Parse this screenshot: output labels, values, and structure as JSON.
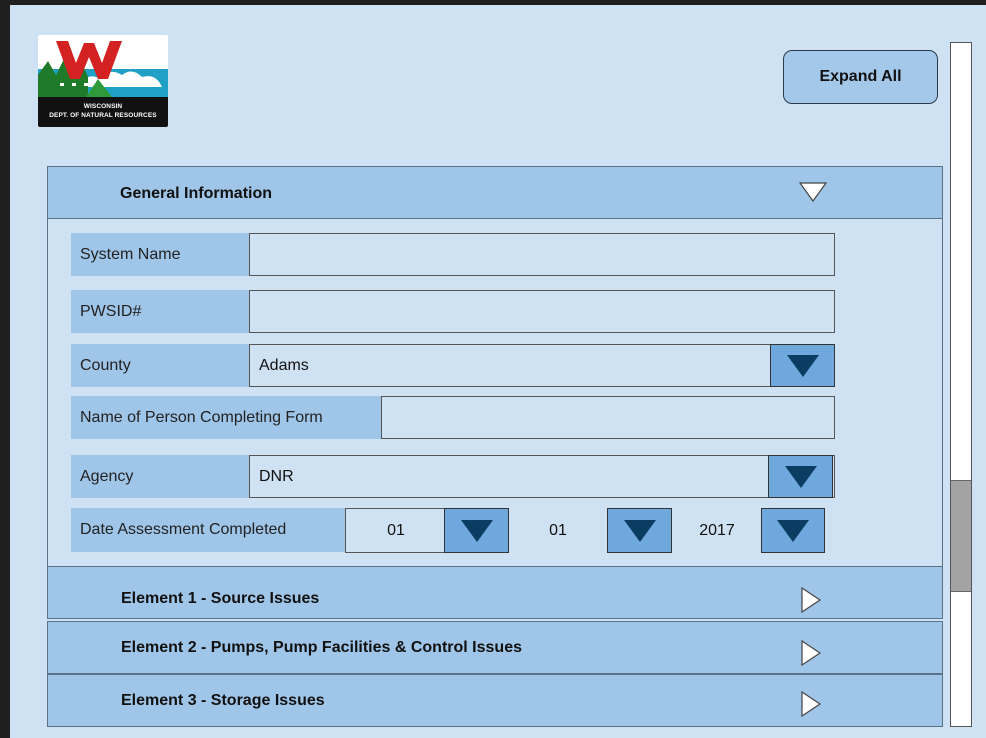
{
  "logo": {
    "line1": "WISCONSIN",
    "line2": "DEPT. OF NATURAL RESOURCES"
  },
  "toolbar": {
    "expand_all_label": "Expand All"
  },
  "sections": {
    "general": {
      "title": "General Information",
      "state": "expanded"
    },
    "element1": {
      "title": "Element 1 - Source Issues",
      "state": "collapsed"
    },
    "element2": {
      "title": "Element 2 - Pumps, Pump Facilities & Control Issues",
      "state": "collapsed"
    },
    "element3": {
      "title": "Element 3 - Storage Issues",
      "state": "collapsed"
    }
  },
  "form": {
    "system_name": {
      "label": "System Name",
      "value": ""
    },
    "pwsid": {
      "label": "PWSID#",
      "value": ""
    },
    "county": {
      "label": "County",
      "value": "Adams"
    },
    "person": {
      "label": "Name of Person Completing Form",
      "value": ""
    },
    "agency": {
      "label": "Agency",
      "value": "DNR"
    },
    "date": {
      "label": "Date Assessment Completed",
      "month": "01",
      "day": "01",
      "year": "2017"
    }
  },
  "colors": {
    "background": "#cfe2f3",
    "header": "#9fc5e8",
    "dropdown_button": "#6fa8dc",
    "arrow": "#0b3d63"
  },
  "icons": {
    "expanded": "triangle-down-icon",
    "collapsed": "triangle-right-icon",
    "dropdown": "dropdown-arrow-icon"
  }
}
